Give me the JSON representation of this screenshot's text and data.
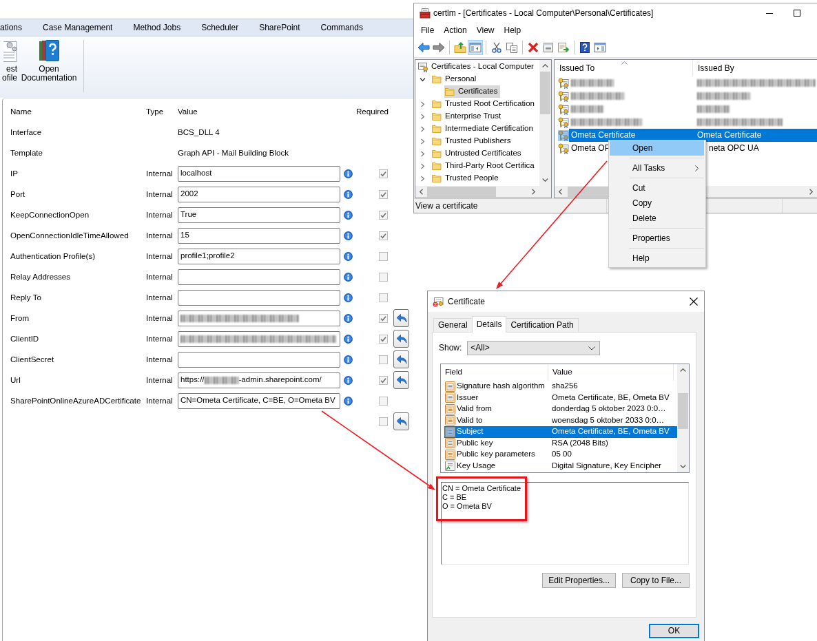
{
  "app": {
    "tabs": [
      {
        "label": "ations",
        "selected": false
      },
      {
        "label": "Case Management",
        "selected": false
      },
      {
        "label": "Method Jobs",
        "selected": false
      },
      {
        "label": "Scheduler",
        "selected": false
      },
      {
        "label": "SharePoint",
        "selected": false
      },
      {
        "label": "Commands",
        "selected": false
      }
    ],
    "ribbon_buttons": [
      {
        "kind": "profile",
        "lines": [
          "est",
          "ofile"
        ]
      },
      {
        "kind": "documentation",
        "lines": [
          "Open",
          "Documentation"
        ]
      }
    ],
    "form": {
      "columns": [
        "Name",
        "Type",
        "Value",
        "Required"
      ],
      "rows": [
        {
          "kind": "info",
          "name": "Interface",
          "value": "BCS_DLL 4"
        },
        {
          "kind": "info",
          "name": "Template",
          "value": "Graph API - Mail Building Block"
        },
        {
          "kind": "field",
          "name": "IP",
          "type": "Internal",
          "value": "localhost",
          "required": true,
          "revert": false
        },
        {
          "kind": "field",
          "name": "Port",
          "type": "Internal",
          "value": "2002",
          "required": true,
          "revert": false
        },
        {
          "kind": "field",
          "name": "KeepConnectionOpen",
          "type": "Internal",
          "value": "True",
          "required": true,
          "revert": false
        },
        {
          "kind": "field",
          "name": "OpenConnectionIdleTimeAllowed",
          "type": "Internal",
          "value": "15",
          "required": true,
          "revert": false
        },
        {
          "kind": "field",
          "name": "Authentication Profile(s)",
          "type": "Internal",
          "value": "profile1;profile2",
          "required": false,
          "revert": false
        },
        {
          "kind": "field",
          "name": "Relay Addresses",
          "type": "Internal",
          "required": false,
          "revert": false
        },
        {
          "kind": "field",
          "name": "Reply To",
          "type": "Internal",
          "required": false,
          "revert": false
        },
        {
          "kind": "field",
          "name": "From",
          "type": "Internal",
          "value_redacted": true,
          "required": true,
          "revert": true
        },
        {
          "kind": "field",
          "name": "ClientID",
          "type": "Internal",
          "value_redacted": true,
          "required": true,
          "revert": true
        },
        {
          "kind": "field",
          "name": "ClientSecret",
          "type": "Internal",
          "required": false,
          "revert": true
        },
        {
          "kind": "field",
          "name": "Url",
          "type": "Internal",
          "value_prefix": "https://",
          "value_redacted": true,
          "value_suffix": "-admin.sharepoint.com/",
          "required": true,
          "revert": true
        },
        {
          "kind": "field",
          "name": "SharePointOnlineAzureADCertificate",
          "type": "Internal",
          "value": "CN=Ometa Certificate, C=BE, O=Ometa BV",
          "required": false,
          "revert": false
        },
        {
          "kind": "controls",
          "required": false,
          "revert": true
        }
      ]
    }
  },
  "certlm": {
    "title": "certlm - [Certificates - Local Computer\\Personal\\Certificates]",
    "menu": [
      "File",
      "Action",
      "View",
      "Help"
    ],
    "toolbar": [
      {
        "kind": "back",
        "pressed": false
      },
      {
        "kind": "forward",
        "pressed": false
      },
      {
        "kind": "separator"
      },
      {
        "kind": "up",
        "pressed": false
      },
      {
        "kind": "tree",
        "pressed": true
      },
      {
        "kind": "separator"
      },
      {
        "kind": "cut",
        "pressed": false
      },
      {
        "kind": "copy",
        "pressed": false
      },
      {
        "kind": "separator"
      },
      {
        "kind": "delete",
        "pressed": false
      },
      {
        "kind": "properties",
        "pressed": false
      },
      {
        "kind": "export",
        "pressed": false
      },
      {
        "kind": "separator"
      },
      {
        "kind": "help",
        "pressed": false
      },
      {
        "kind": "pane",
        "pressed": false
      }
    ],
    "tree": {
      "label": "Certificates - Local Computer",
      "selected": false,
      "children": [
        {
          "label": "Personal",
          "expanded": true,
          "selected": false,
          "children": [
            {
              "label": "Certificates",
              "selected": true
            }
          ]
        },
        {
          "label": "Trusted Root Certification",
          "expanded": false,
          "selected": false
        },
        {
          "label": "Enterprise Trust",
          "expanded": false,
          "selected": false
        },
        {
          "label": "Intermediate Certification",
          "expanded": false,
          "selected": false
        },
        {
          "label": "Trusted Publishers",
          "expanded": false,
          "selected": false
        },
        {
          "label": "Untrusted Certificates",
          "expanded": false,
          "selected": false
        },
        {
          "label": "Third-Party Root Certifica",
          "expanded": false,
          "selected": false
        },
        {
          "label": "Trusted People",
          "expanded": false,
          "selected": false
        }
      ]
    },
    "list": {
      "columns": [
        {
          "label": "Issued To",
          "sorted": true
        },
        {
          "label": "Issued By",
          "sorted": false
        }
      ],
      "rows": [
        {
          "issued_to_redacted": true,
          "issued_by_redacted": true,
          "selected": false
        },
        {
          "issued_to_redacted": true,
          "issued_by_redacted": true,
          "selected": false
        },
        {
          "issued_to_redacted": true,
          "issued_by_redacted": true,
          "selected": false
        },
        {
          "issued_to_redacted": true,
          "issued_by_redacted": true,
          "selected": false
        },
        {
          "issued_to": "Ometa Certificate",
          "issued_by": "Ometa Certificate",
          "selected": true
        },
        {
          "issued_to": "Ometa OP",
          "issued_by": "neta OPC UA",
          "issued_by_covered": true,
          "selected": false
        }
      ]
    },
    "status_bar": "View a certificate"
  },
  "context_menu": {
    "items": [
      {
        "kind": "item",
        "label": "Open",
        "selected": true,
        "submenu": false
      },
      {
        "kind": "separator"
      },
      {
        "kind": "item",
        "label": "All Tasks",
        "selected": false,
        "submenu": true
      },
      {
        "kind": "separator"
      },
      {
        "kind": "item",
        "label": "Cut",
        "selected": false,
        "submenu": false
      },
      {
        "kind": "item",
        "label": "Copy",
        "selected": false,
        "submenu": false
      },
      {
        "kind": "item",
        "label": "Delete",
        "selected": false,
        "submenu": false
      },
      {
        "kind": "separator"
      },
      {
        "kind": "item",
        "label": "Properties",
        "selected": false,
        "submenu": false
      },
      {
        "kind": "separator"
      },
      {
        "kind": "item",
        "label": "Help",
        "selected": false,
        "submenu": false
      }
    ]
  },
  "certificate_dialog": {
    "title": "Certificate",
    "tabs": [
      {
        "label": "General",
        "selected": false
      },
      {
        "label": "Details",
        "selected": true
      },
      {
        "label": "Certification Path",
        "selected": false
      }
    ],
    "show_label": "Show:",
    "show_value": "<All>",
    "field_list": {
      "columns": [
        "Field",
        "Value"
      ],
      "rows": [
        {
          "kind": "property",
          "field": "Signature hash algorithm",
          "value": "sha256",
          "selected": false
        },
        {
          "kind": "property",
          "field": "Issuer",
          "value": "Ometa Certificate, BE, Ometa BV",
          "selected": false
        },
        {
          "kind": "property",
          "field": "Valid from",
          "value": "donderdag 5 oktober 2023 0:0…",
          "selected": false
        },
        {
          "kind": "property",
          "field": "Valid to",
          "value": "woensdag 5 oktober 2033 0:0…",
          "selected": false
        },
        {
          "kind": "property",
          "field": "Subject",
          "value": "Ometa Certificate, BE, Ometa BV",
          "selected": true
        },
        {
          "kind": "property",
          "field": "Public key",
          "value": "RSA (2048 Bits)",
          "selected": false
        },
        {
          "kind": "property",
          "field": "Public key parameters",
          "value": "05 00",
          "selected": false
        },
        {
          "kind": "extension",
          "field": "Key Usage",
          "value": "Digital Signature, Key Encipher",
          "selected": false
        }
      ]
    },
    "detail_lines": [
      "CN = Ometa Certificate",
      "C = BE",
      "O = Ometa BV"
    ],
    "buttons": [
      "Edit Properties...",
      "Copy to File..."
    ],
    "ok_button": "OK"
  }
}
